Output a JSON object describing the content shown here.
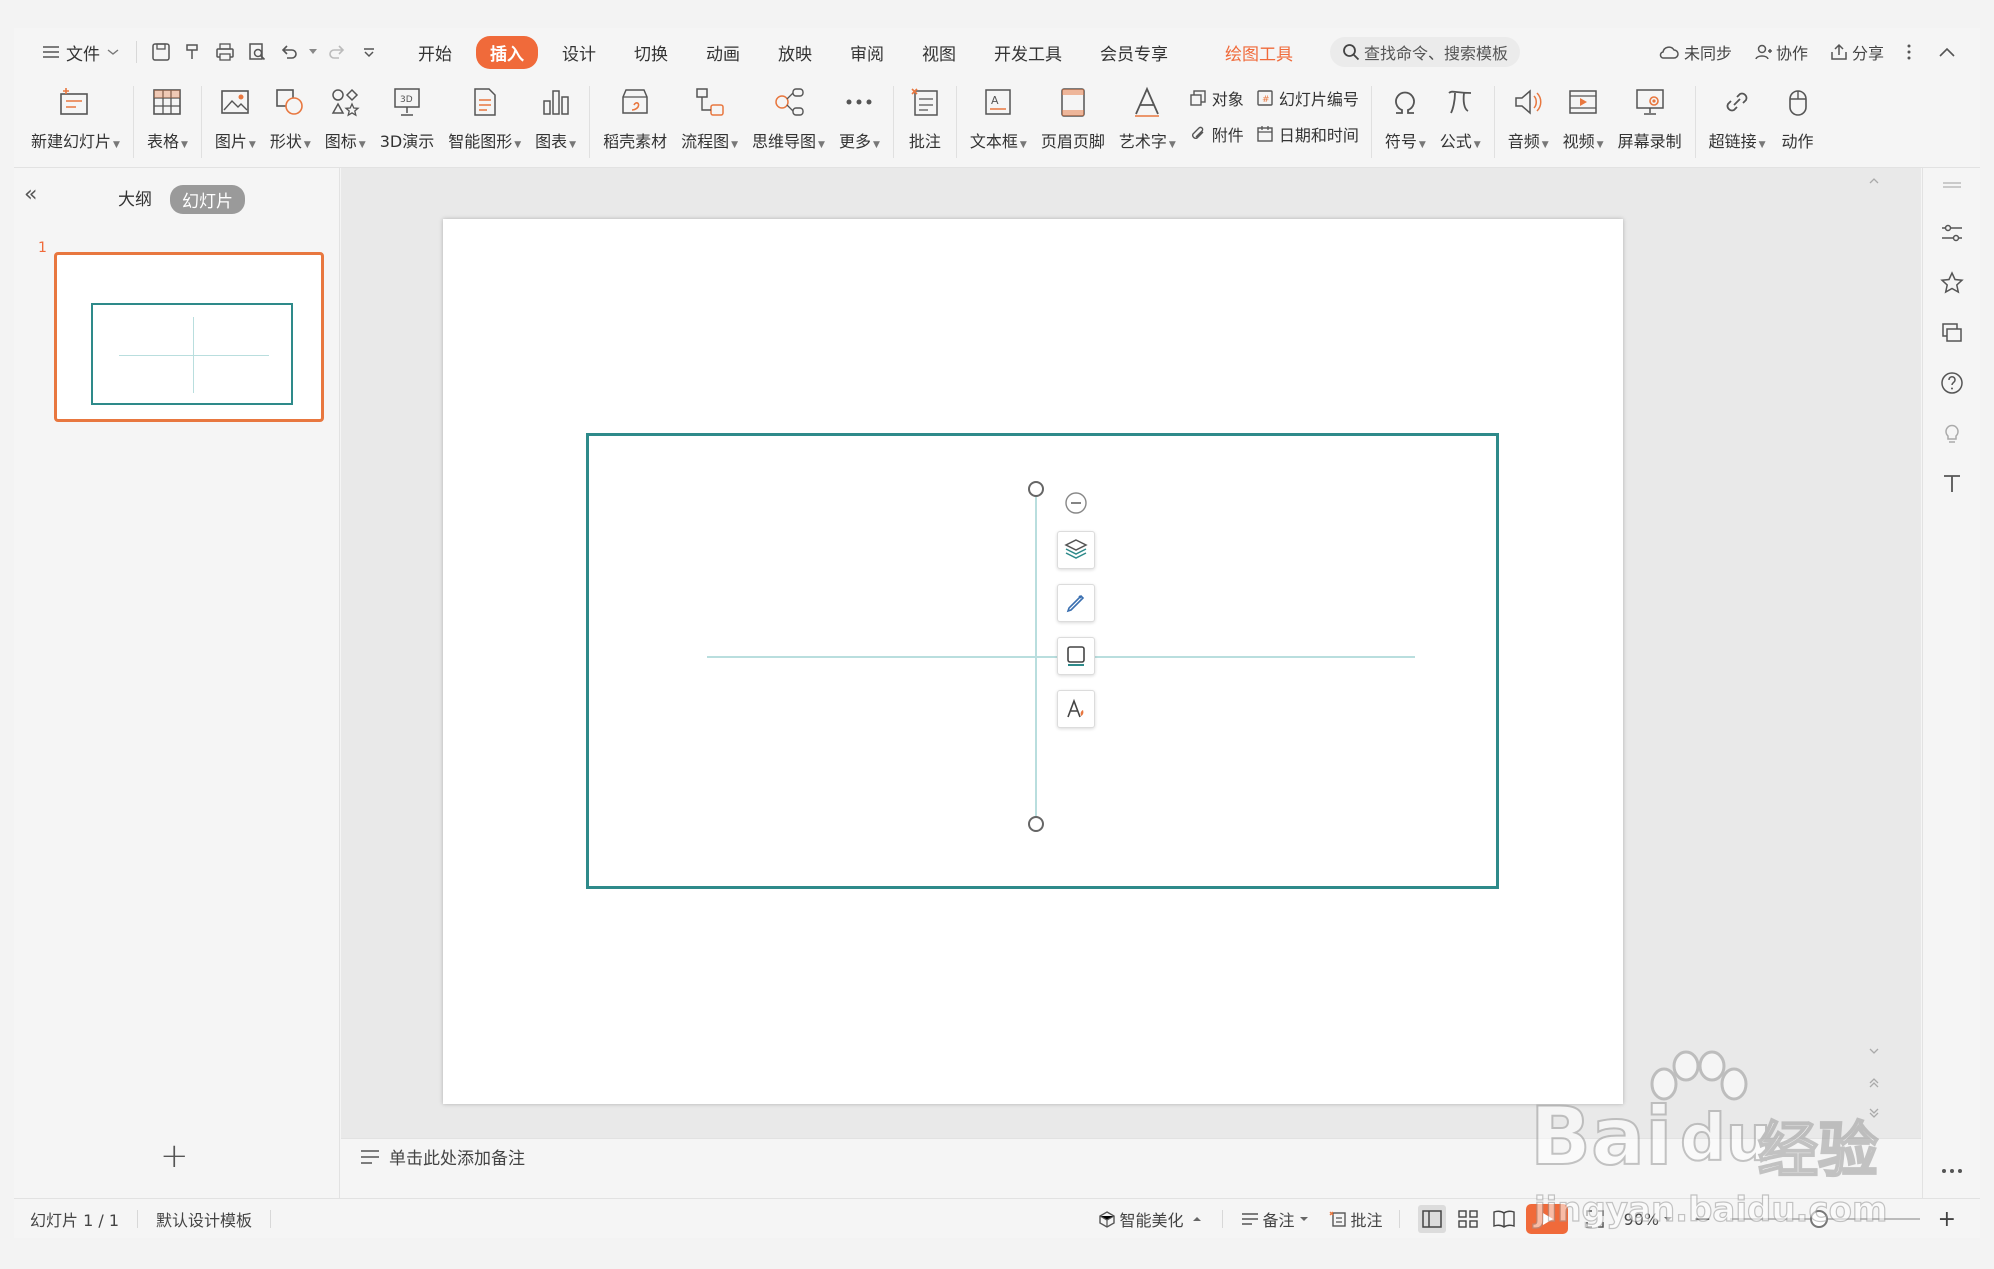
{
  "menubar": {
    "file_label": "文件",
    "tabs": [
      {
        "label": "开始",
        "active": false
      },
      {
        "label": "插入",
        "active": true
      },
      {
        "label": "设计",
        "active": false
      },
      {
        "label": "切换",
        "active": false
      },
      {
        "label": "动画",
        "active": false
      },
      {
        "label": "放映",
        "active": false
      },
      {
        "label": "审阅",
        "active": false
      },
      {
        "label": "视图",
        "active": false
      },
      {
        "label": "开发工具",
        "active": false
      },
      {
        "label": "会员专享",
        "active": false
      }
    ],
    "drawing_tools_label": "绘图工具",
    "search_placeholder": "查找命令、搜索模板",
    "sync_label": "未同步",
    "collab_label": "协作",
    "share_label": "分享"
  },
  "ribbon": {
    "new_slide": "新建幻灯片",
    "table": "表格",
    "picture": "图片",
    "shape": "形状",
    "icon": "图标",
    "demo3d": "3D演示",
    "smart_graphic": "智能图形",
    "chart": "图表",
    "daoke": "稻壳素材",
    "flowchart": "流程图",
    "mindmap": "思维导图",
    "more": "更多",
    "comment": "批注",
    "textbox": "文本框",
    "header_footer": "页眉页脚",
    "wordart": "艺术字",
    "object": "对象",
    "attachment": "附件",
    "slide_number": "幻灯片编号",
    "datetime": "日期和时间",
    "symbol": "符号",
    "formula": "公式",
    "audio": "音频",
    "video": "视频",
    "screen_record": "屏幕录制",
    "hyperlink": "超链接",
    "action": "动作"
  },
  "leftpanel": {
    "outline_tab": "大纲",
    "slides_tab": "幻灯片",
    "slide_number": "1"
  },
  "notes": {
    "placeholder": "单击此处添加备注"
  },
  "statusbar": {
    "slide_info": "幻灯片 1 / 1",
    "template": "默认设计模板",
    "smart_beautify": "智能美化",
    "notes": "备注",
    "comments": "批注",
    "zoom": "90%"
  },
  "watermark": {
    "brand": "Bai",
    "brand2": "du",
    "suffix": "经验",
    "url": "jingyan.baidu.com"
  },
  "colors": {
    "accent": "#f06a3a",
    "shape_border": "#2e8a8a",
    "line": "#b9dede"
  }
}
